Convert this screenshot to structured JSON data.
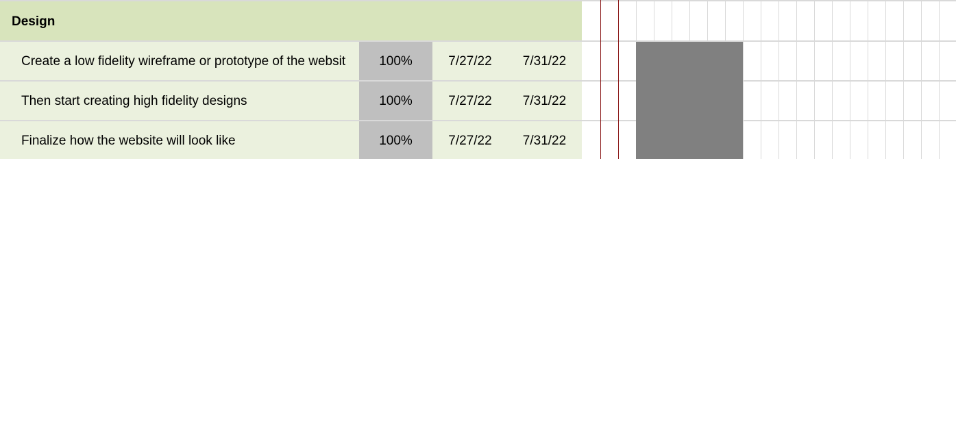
{
  "section": {
    "title": "Design"
  },
  "tasks": [
    {
      "name": "Create a low fidelity wireframe or prototype of the websit",
      "progress": "100%",
      "start": "7/27/22",
      "end": "7/31/22"
    },
    {
      "name": "Then start creating high fidelity designs",
      "progress": "100%",
      "start": "7/27/22",
      "end": "7/31/22"
    },
    {
      "name": "Finalize how the website will look like",
      "progress": "100%",
      "start": "7/27/22",
      "end": "7/31/22"
    }
  ],
  "colors": {
    "section_bg": "#d8e4bc",
    "task_bg": "#ebf1de",
    "progress_bg": "#bfbfbf",
    "gantt_bar": "#808080",
    "today_line": "#8b1a1a",
    "grid": "#d9d9d9"
  }
}
